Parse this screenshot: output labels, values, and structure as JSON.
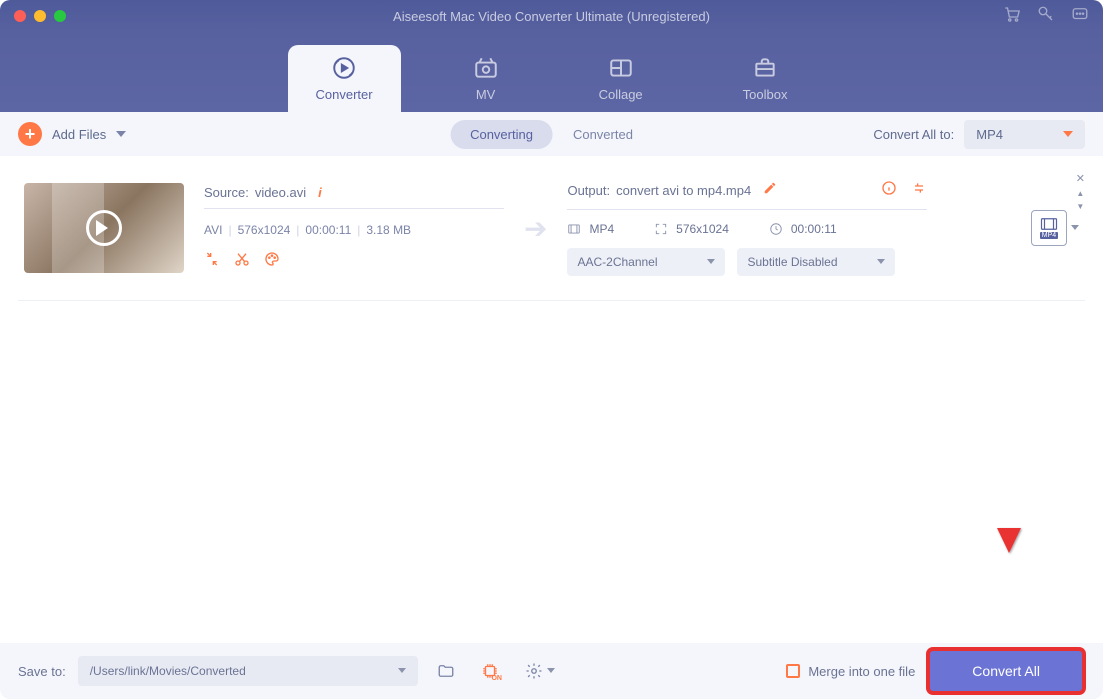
{
  "window": {
    "title": "Aiseesoft Mac Video Converter Ultimate (Unregistered)"
  },
  "nav": {
    "converter": "Converter",
    "mv": "MV",
    "collage": "Collage",
    "toolbox": "Toolbox"
  },
  "toolbar": {
    "add_files": "Add Files",
    "tab_converting": "Converting",
    "tab_converted": "Converted",
    "convert_all_to": "Convert All to:",
    "format": "MP4"
  },
  "item": {
    "source_label": "Source:",
    "source_file": "video.avi",
    "codec": "AVI",
    "resolution": "576x1024",
    "duration": "00:00:11",
    "size": "3.18 MB",
    "output_label": "Output:",
    "output_file": "convert avi to mp4.mp4",
    "out_format": "MP4",
    "out_resolution": "576x1024",
    "out_duration": "00:00:11",
    "audio": "AAC-2Channel",
    "subtitle": "Subtitle Disabled",
    "fmt_badge": "MP4"
  },
  "footer": {
    "save_to": "Save to:",
    "path": "/Users/link/Movies/Converted",
    "merge": "Merge into one file",
    "convert_all": "Convert All"
  }
}
